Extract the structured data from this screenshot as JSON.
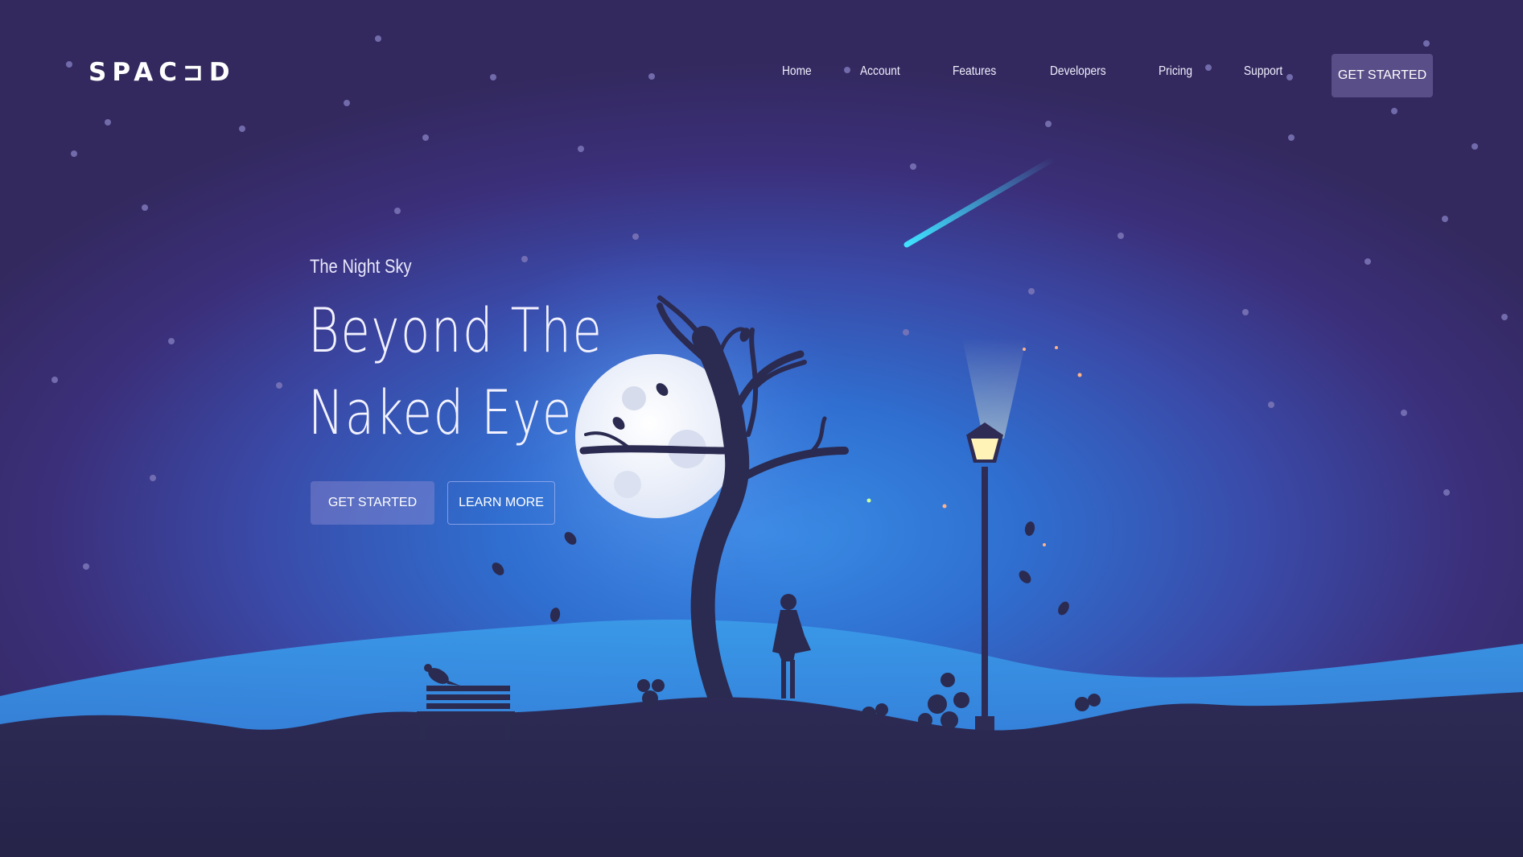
{
  "brand": {
    "logo_text": "SPAC⊐D"
  },
  "nav": {
    "items": [
      {
        "label": "Home"
      },
      {
        "label": "Account"
      },
      {
        "label": "Features"
      },
      {
        "label": "Developers"
      },
      {
        "label": "Pricing"
      },
      {
        "label": "Support"
      }
    ],
    "cta_label": "GET STARTED"
  },
  "hero": {
    "eyebrow": "The Night Sky",
    "title_line1": "Beyond The",
    "title_line2": "Naked Eye",
    "primary_button": "GET STARTED",
    "secondary_button": "LEARN MORE"
  },
  "colors": {
    "sky_top": "#33295e",
    "sky_glow": "#3a8ee6",
    "hill_dark": "#2c2a52",
    "silhouette": "#2b2a50",
    "moon": "#f4f5fb",
    "meteor": "#38d9f5"
  },
  "illustration": {
    "elements": [
      "moon",
      "bare-tree",
      "person-silhouette",
      "street-lamp",
      "park-bench",
      "bird",
      "shooting-star",
      "stars",
      "falling-leaves",
      "hills"
    ]
  }
}
